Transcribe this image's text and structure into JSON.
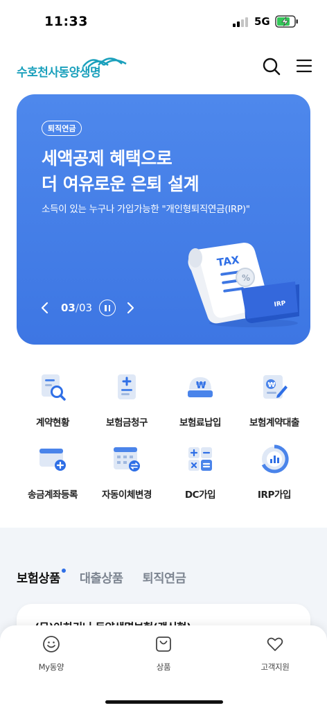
{
  "status_bar": {
    "time": "11:33",
    "network": "5G",
    "battery_state": "charging",
    "signal_bars_active": 2
  },
  "header": {
    "logo_text": "수호천사동양생명",
    "search_icon": "search-icon",
    "menu_icon": "hamburger-menu-icon"
  },
  "banner": {
    "badge": "퇴직연금",
    "title_line1": "세액공제 혜택으로",
    "title_line2": "더 여유로운 은퇴 설계",
    "subtitle": "소득이 있는 누구나 가입가능한 \"개인형퇴직연금(IRP)\"",
    "current_page": "03",
    "separator": "/",
    "total_pages": "03",
    "illustration_tax_text": "TAX",
    "illustration_card_text": "IRP",
    "background_color": "#4a84ea"
  },
  "quick_menu": [
    {
      "label": "계약현황",
      "icon": "contract-search-icon"
    },
    {
      "label": "보험금청구",
      "icon": "claim-document-icon"
    },
    {
      "label": "보험료납입",
      "icon": "premium-payment-icon"
    },
    {
      "label": "보험계약대출",
      "icon": "loan-document-icon"
    },
    {
      "label": "송금계좌등록",
      "icon": "account-add-icon"
    },
    {
      "label": "자동이체변경",
      "icon": "auto-transfer-icon"
    },
    {
      "label": "DC가입",
      "icon": "calculator-icon"
    },
    {
      "label": "IRP가입",
      "icon": "chart-gauge-icon"
    }
  ],
  "products": {
    "tabs": [
      {
        "label": "보험상품",
        "active": true
      },
      {
        "label": "대출상품",
        "active": false
      },
      {
        "label": "퇴직연금",
        "active": false
      }
    ],
    "card_title": "(무)아하기니 동양생명보험(갱신형)"
  },
  "bottom_nav": [
    {
      "label": "My동양",
      "icon": "smile-face-icon"
    },
    {
      "label": "상품",
      "icon": "shopping-bag-icon"
    },
    {
      "label": "고객지원",
      "icon": "heart-icon"
    }
  ],
  "colors": {
    "accent": "#2f6fe6",
    "brand_teal": "#1aa0bc",
    "section_bg": "#f2f5f9"
  }
}
